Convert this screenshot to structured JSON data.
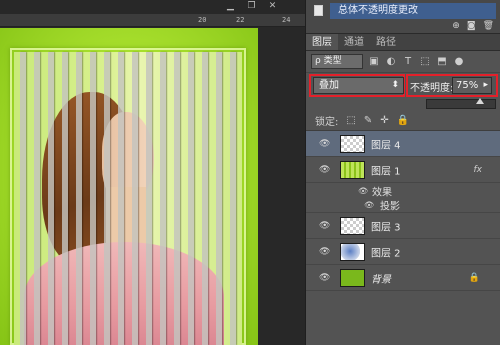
{
  "window_controls": {
    "minimize": "▁",
    "restore": "❐",
    "close": "✕"
  },
  "ruler": {
    "ticks": [
      "20",
      "22",
      "24"
    ]
  },
  "history": {
    "item_label": "总体不透明度更改",
    "toolbar_icons": [
      "new-snapshot-icon",
      "camera-icon",
      "trash-icon"
    ],
    "toolbar_glyphs": [
      "⊕",
      "◙",
      "🗑"
    ]
  },
  "tabs": [
    {
      "label": "图层"
    },
    {
      "label": "通道"
    },
    {
      "label": "路径"
    }
  ],
  "filter": {
    "value": "ρ 类型",
    "icons": [
      "▣",
      "◐",
      "T",
      "⬚",
      "⬒",
      "●"
    ]
  },
  "blend_mode": {
    "value": "叠加",
    "arrow": "⬍"
  },
  "opacity": {
    "label": "不透明度:",
    "value": "75%",
    "arrow": "▸",
    "level": 0.75
  },
  "lock": {
    "label": "锁定:",
    "icons": [
      "⬚",
      "✎",
      "✛",
      "🔒"
    ]
  },
  "layers": [
    {
      "name": "图层 4",
      "thumb": "checker",
      "selected": true
    },
    {
      "name": "图层 1",
      "thumb": "stripes",
      "fx": "fx"
    },
    {
      "effects_label": "效果",
      "effect_name": "投影"
    },
    {
      "name": "图层 3",
      "thumb": "checker"
    },
    {
      "name": "图层 2",
      "thumb": "photo"
    },
    {
      "name": "背景",
      "thumb": "green",
      "locked": true
    }
  ],
  "colors": {
    "highlight_border": "#e4202a",
    "selection": "#5f6b7d",
    "history_active": "#3f5f8f"
  }
}
